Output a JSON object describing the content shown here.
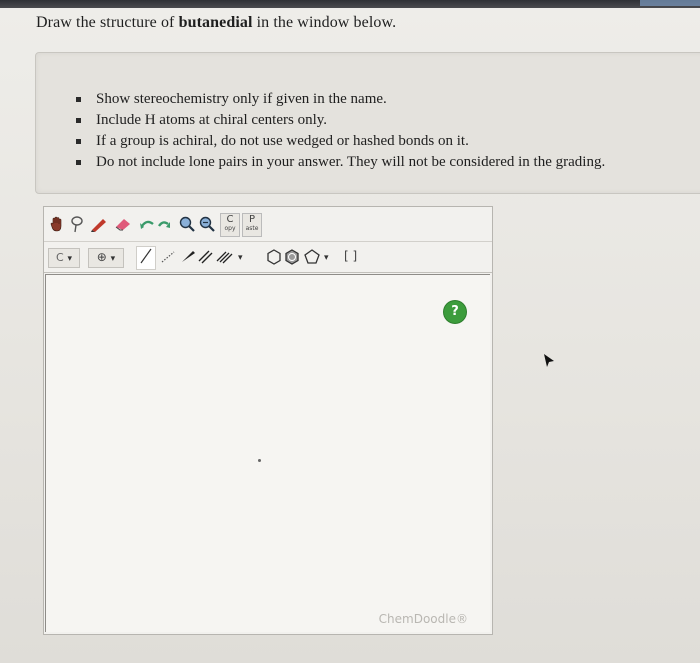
{
  "question": {
    "prefix": "Draw the structure of ",
    "compound": "butanedial",
    "suffix": " in the window below."
  },
  "instructions": [
    "Show stereochemistry only if given in the name.",
    "Include H atoms at chiral centers only.",
    "If a group is achiral, do not use wedged or hashed bonds on it.",
    "Do not include lone pairs in your answer. They will not be considered in the grading."
  ],
  "toolbar": {
    "atom_selector": "C",
    "clean_label": "C",
    "clean_sub": "opy",
    "paste_label": "P",
    "paste_sub": "aste",
    "bracket_label": "[ ]"
  },
  "editor": {
    "help_label": "?",
    "watermark": "ChemDoodle®"
  },
  "colors": {
    "help_green": "#3c9c3c",
    "pencil_red": "#c0392b",
    "eraser_pink": "#e05a7a",
    "arrow_green": "#3a9a6a"
  },
  "icons": [
    "hand-icon",
    "lasso-icon",
    "pencil-icon",
    "eraser-icon",
    "undo-icon",
    "redo-icon",
    "zoom-in-icon",
    "zoom-out-icon",
    "copy-icon",
    "paste-icon",
    "charge-plus-icon",
    "single-bond-icon",
    "hashed-bond-icon",
    "wedge-bond-icon",
    "double-bond-icon",
    "triple-bond-icon",
    "hexagon-ring-icon",
    "benzene-ring-icon",
    "pentagon-ring-icon",
    "bracket-icon",
    "help-icon",
    "mouse-cursor-icon"
  ]
}
